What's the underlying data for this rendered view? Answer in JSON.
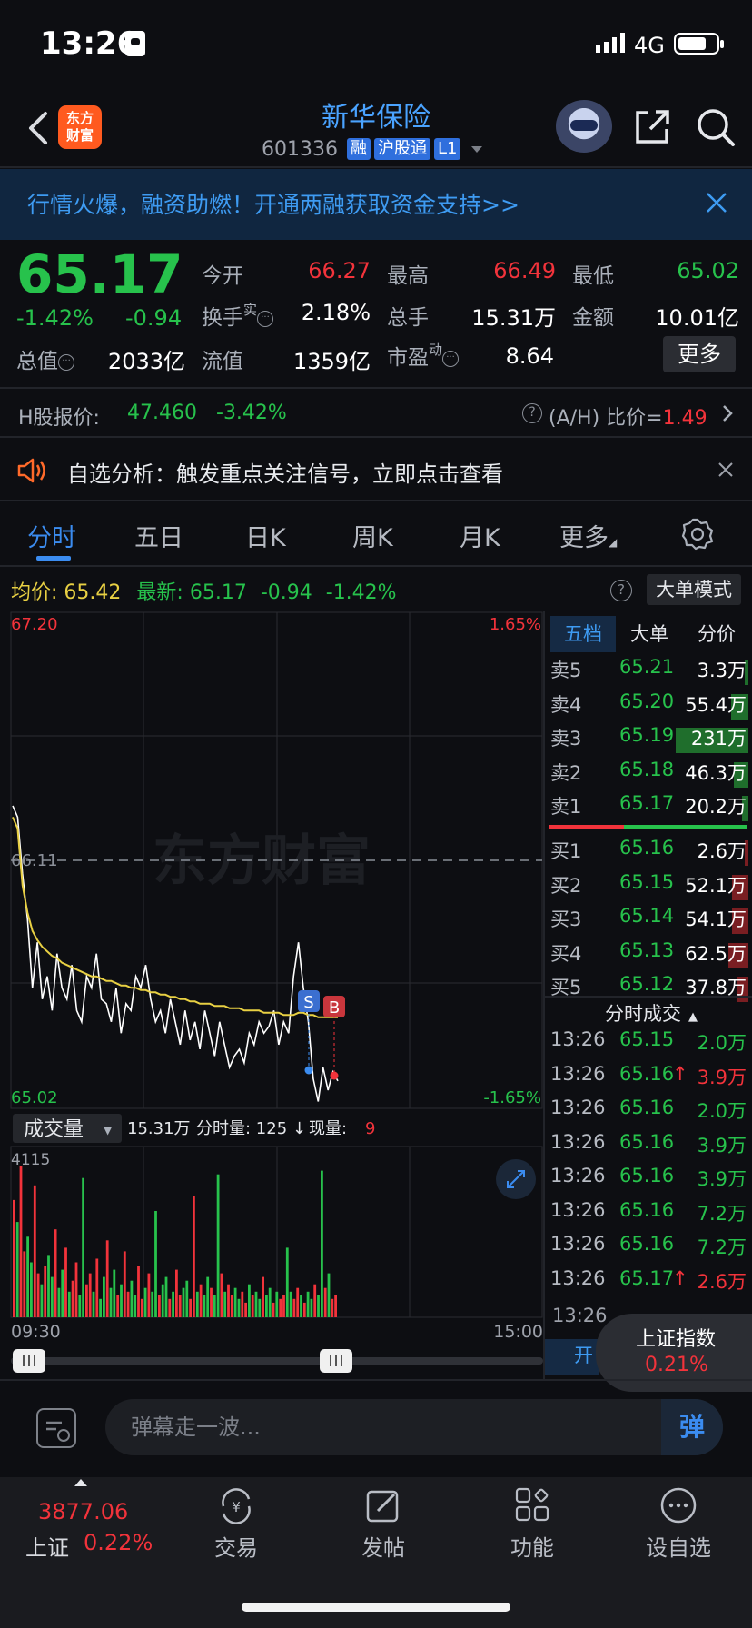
{
  "status_bar": {
    "time": "13:26",
    "network": "4G"
  },
  "header": {
    "logo_line1": "东方",
    "logo_line2": "财富",
    "stock_name": "新华保险",
    "stock_code": "601336",
    "tags": [
      "融",
      "沪股通",
      "L1"
    ]
  },
  "banner": {
    "text": "行情火爆，融资助燃！开通两融获取资金支持>>"
  },
  "quote": {
    "price": "65.17",
    "pct_change": "-1.42%",
    "abs_change": "-0.94",
    "open_label": "今开",
    "open": "66.27",
    "high_label": "最高",
    "high": "66.49",
    "low_label": "最低",
    "low": "65.02",
    "turnover_label": "换手",
    "turnover_sup": "实",
    "turnover": "2.18%",
    "volume_label": "总手",
    "volume": "15.31万",
    "amount_label": "金额",
    "amount": "10.01亿",
    "mktcap_label": "总值",
    "mktcap": "2033亿",
    "float_label": "流值",
    "float_cap": "1359亿",
    "pe_label": "市盈",
    "pe_sup": "动",
    "pe": "8.64",
    "more_label": "更多"
  },
  "h_share": {
    "label": "H股报价:",
    "price": "47.460",
    "pct": "-3.42%",
    "ah_label": "(A/H) 比价=",
    "ah_value": "1.49"
  },
  "analysis": {
    "text": "自选分析：触发重点关注信号，立即点击查看"
  },
  "tabs": [
    "分时",
    "五日",
    "日K",
    "周K",
    "月K",
    "更多"
  ],
  "avg_row": {
    "avg_label": "均价:",
    "avg_value": "65.42",
    "latest_label": "最新:",
    "latest_value": "65.17",
    "latest_change": "-0.94",
    "latest_pct": "-1.42%",
    "big_order_mode": "大单模式"
  },
  "chart_labels": {
    "y_top": "67.20",
    "y_top_pct": "1.65%",
    "y_mid": "66.11",
    "y_bottom": "65.02",
    "y_bottom_pct": "-1.65%",
    "watermark": "东方财富",
    "marker_s": "S",
    "marker_b": "B",
    "vol_selector": "成交量",
    "vol_total": "15.31万",
    "vol_minute_label": "分时量: 125",
    "vol_now_label": "现量:",
    "vol_now_value": "9",
    "vol_max": "4115",
    "x_start": "09:30",
    "x_end": "15:00"
  },
  "chart_data": {
    "type": "line",
    "title": "",
    "xlabel": "",
    "ylabel": "",
    "x": [
      "09:30",
      "15:00"
    ],
    "ylim": [
      65.02,
      67.2
    ],
    "reference_price": 66.11,
    "series": [
      {
        "name": "",
        "color": "#ffffff",
        "values": [
          66.35,
          66.3,
          66.05,
          65.85,
          65.55,
          65.75,
          65.5,
          65.6,
          65.45,
          65.7,
          65.55,
          65.5,
          65.65,
          65.45,
          65.4,
          65.6,
          65.55,
          65.7,
          65.5,
          65.48,
          65.4,
          65.55,
          65.35,
          65.48,
          65.45,
          65.6,
          65.55,
          65.65,
          65.5,
          65.4,
          65.45,
          65.35,
          65.5,
          65.4,
          65.3,
          65.45,
          65.32,
          65.4,
          65.28,
          65.45,
          65.35,
          65.25,
          65.4,
          65.3,
          65.2,
          65.25,
          65.28,
          65.22,
          65.35,
          65.3,
          65.4,
          65.35,
          65.38,
          65.45,
          65.3,
          65.4,
          65.35,
          65.6,
          65.75,
          65.55,
          65.4,
          65.15,
          65.05,
          65.2,
          65.1,
          65.18,
          65.14
        ]
      },
      {
        "name": "",
        "color": "#e8d043",
        "values": [
          66.3,
          66.25,
          66.0,
          65.88,
          65.8,
          65.76,
          65.73,
          65.71,
          65.69,
          65.68,
          65.66,
          65.65,
          65.64,
          65.63,
          65.62,
          65.61,
          65.6,
          65.6,
          65.59,
          65.58,
          65.58,
          65.57,
          65.56,
          65.56,
          65.55,
          65.55,
          65.54,
          65.54,
          65.53,
          65.53,
          65.52,
          65.52,
          65.51,
          65.51,
          65.5,
          65.5,
          65.49,
          65.49,
          65.48,
          65.48,
          65.48,
          65.47,
          65.47,
          65.47,
          65.46,
          65.46,
          65.46,
          65.45,
          65.45,
          65.45,
          65.45,
          65.44,
          65.44,
          65.44,
          65.44,
          65.43,
          65.43,
          65.43,
          65.44,
          65.44,
          65.43,
          65.43,
          65.42,
          65.42,
          65.42,
          65.42,
          65.42
        ]
      }
    ],
    "volume": {
      "max": 4115,
      "values": [
        3200,
        2600,
        4115,
        1800,
        2200,
        1500,
        3600,
        1200,
        900,
        1400,
        1700,
        1100,
        2400,
        800,
        1300,
        1900,
        700,
        1000,
        1500,
        600,
        3800,
        900,
        1200,
        700,
        1600,
        500,
        1100,
        2100,
        800,
        1300,
        600,
        900,
        1800,
        700,
        1000,
        600,
        1400,
        500,
        800,
        1200,
        700,
        2900,
        600,
        900,
        1100,
        500,
        700,
        1300,
        600,
        800,
        1000,
        500,
        3300,
        700,
        900,
        600,
        1100,
        800,
        600,
        3900,
        1200,
        700,
        900,
        600,
        800,
        500,
        700,
        400,
        900,
        600,
        700,
        500,
        1100,
        600,
        800,
        400,
        700,
        500,
        600,
        1900,
        700,
        500,
        800,
        600,
        400,
        700,
        500,
        900,
        600,
        4000,
        800,
        1200,
        500,
        600
      ],
      "colors": "alternating red/green by price direction"
    }
  },
  "order_book": {
    "tabs": [
      "五档",
      "大单",
      "分价"
    ],
    "asks": [
      {
        "label": "卖5",
        "price": "65.21",
        "vol": "3.3万",
        "level": 0.05
      },
      {
        "label": "卖4",
        "price": "65.20",
        "vol": "55.4万",
        "level": 0.24
      },
      {
        "label": "卖3",
        "price": "65.19",
        "vol": "231万",
        "level": 1.0
      },
      {
        "label": "卖2",
        "price": "65.18",
        "vol": "46.3万",
        "level": 0.2
      },
      {
        "label": "卖1",
        "price": "65.17",
        "vol": "20.2万",
        "level": 0.09
      }
    ],
    "bids": [
      {
        "label": "买1",
        "price": "65.16",
        "vol": "2.6万",
        "level": 0.01
      },
      {
        "label": "买2",
        "price": "65.15",
        "vol": "52.1万",
        "level": 0.23
      },
      {
        "label": "买3",
        "price": "65.14",
        "vol": "54.1万",
        "level": 0.23
      },
      {
        "label": "买4",
        "price": "65.13",
        "vol": "62.5万",
        "level": 0.27
      },
      {
        "label": "买5",
        "price": "65.12",
        "vol": "37.8万",
        "level": 0.16
      }
    ]
  },
  "trades": {
    "title": "分时成交",
    "rows": [
      {
        "time": "13:26",
        "price": "65.15",
        "arrow": "",
        "vol": "2.0万",
        "vol_color": "green"
      },
      {
        "time": "13:26",
        "price": "65.16",
        "arrow": "↑",
        "vol": "3.9万",
        "vol_color": "red"
      },
      {
        "time": "13:26",
        "price": "65.16",
        "arrow": "",
        "vol": "2.0万",
        "vol_color": "green"
      },
      {
        "time": "13:26",
        "price": "65.16",
        "arrow": "",
        "vol": "3.9万",
        "vol_color": "green"
      },
      {
        "time": "13:26",
        "price": "65.16",
        "arrow": "",
        "vol": "3.9万",
        "vol_color": "green"
      },
      {
        "time": "13:26",
        "price": "65.16",
        "arrow": "",
        "vol": "7.2万",
        "vol_color": "green"
      },
      {
        "time": "13:26",
        "price": "65.16",
        "arrow": "",
        "vol": "7.2万",
        "vol_color": "green"
      },
      {
        "time": "13:26",
        "price": "65.17",
        "arrow": "↑",
        "vol": "2.6万",
        "vol_color": "red"
      }
    ],
    "partial_time": "13:26"
  },
  "index_popup": {
    "name": "上证指数",
    "pct": "0.21%",
    "open_label": "开"
  },
  "comment": {
    "placeholder": "弹幕走一波...",
    "danmu_label": "弹"
  },
  "bottom_nav": {
    "index_value": "3877.06",
    "index_name": "上证",
    "index_pct": "0.22%",
    "items": [
      "交易",
      "发帖",
      "功能",
      "设自选"
    ]
  },
  "colors": {
    "up": "#f2333b",
    "down": "#27c24c",
    "accent": "#3b8cf0",
    "avg_line": "#e8d043"
  }
}
